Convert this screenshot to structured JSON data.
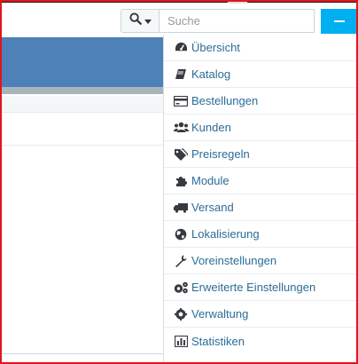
{
  "search": {
    "placeholder": "Suche",
    "value": ""
  },
  "menu": {
    "items": [
      {
        "label": "Übersicht",
        "icon": "dashboard-icon"
      },
      {
        "label": "Katalog",
        "icon": "book-icon"
      },
      {
        "label": "Bestellungen",
        "icon": "credit-card-icon"
      },
      {
        "label": "Kunden",
        "icon": "users-icon"
      },
      {
        "label": "Preisregeln",
        "icon": "tags-icon"
      },
      {
        "label": "Module",
        "icon": "puzzle-icon"
      },
      {
        "label": "Versand",
        "icon": "truck-icon"
      },
      {
        "label": "Lokalisierung",
        "icon": "globe-icon"
      },
      {
        "label": "Voreinstellungen",
        "icon": "wrench-icon"
      },
      {
        "label": "Erweiterte Einstellungen",
        "icon": "cogs-icon"
      },
      {
        "label": "Verwaltung",
        "icon": "cog-icon"
      },
      {
        "label": "Statistiken",
        "icon": "bar-chart-icon"
      }
    ]
  },
  "colors": {
    "accent": "#00aff0",
    "header": "#4d81b8",
    "link": "#2a6d96",
    "frame": "#e0161c"
  }
}
